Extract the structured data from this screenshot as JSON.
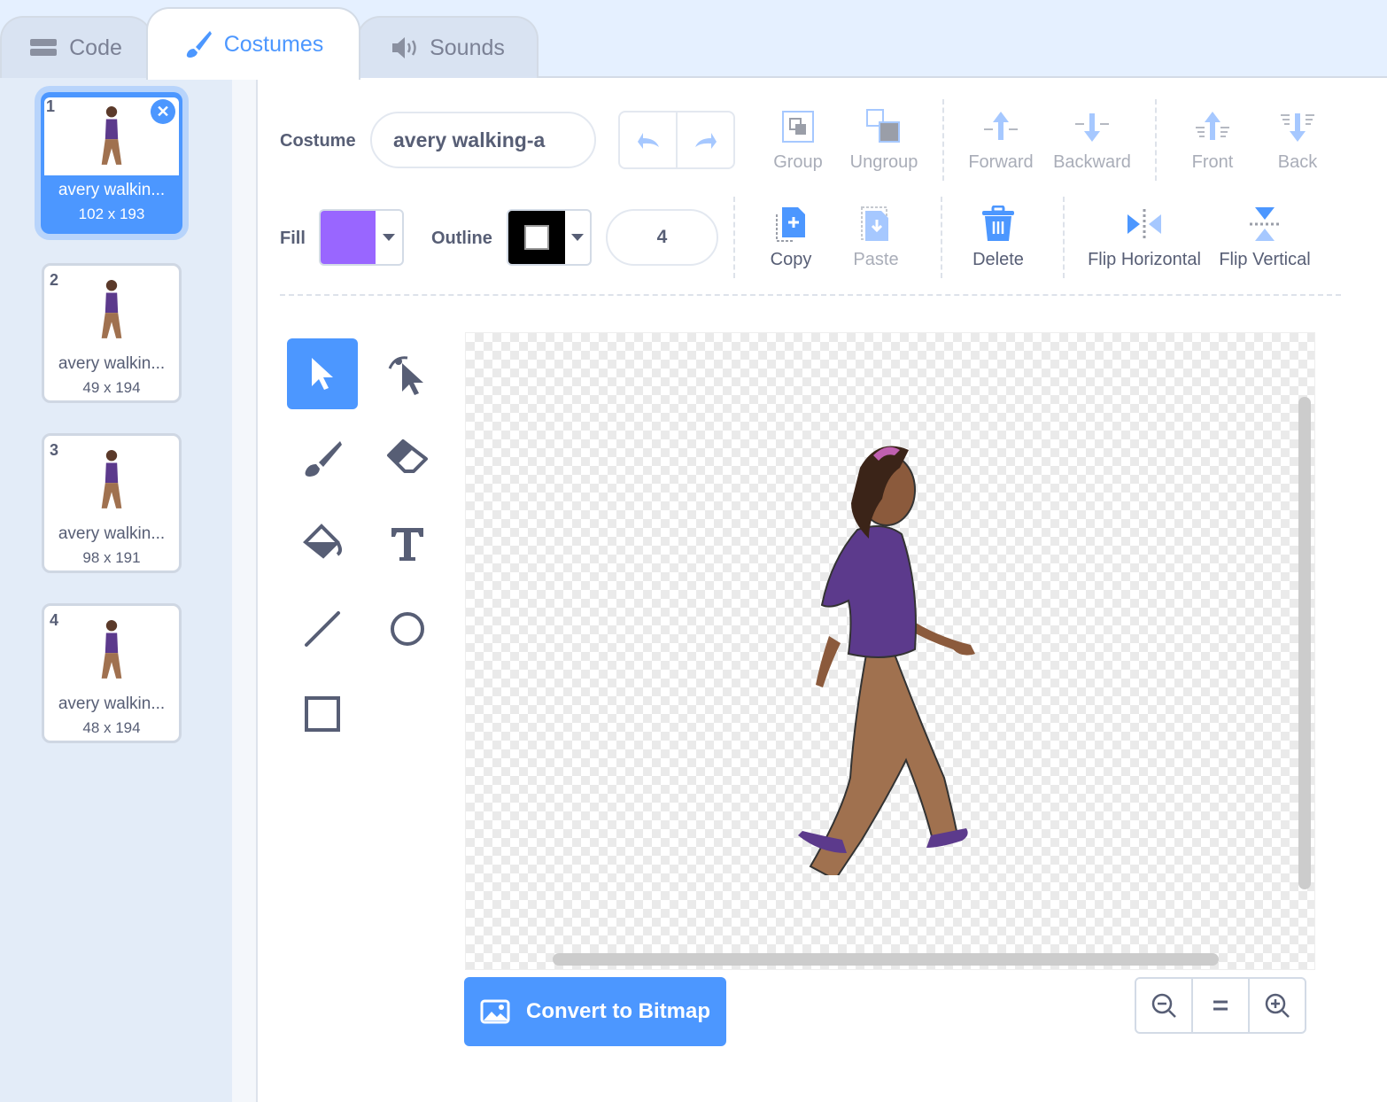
{
  "tabs": [
    {
      "label": "Code",
      "icon": "code-icon"
    },
    {
      "label": "Costumes",
      "icon": "brush-icon",
      "active": true
    },
    {
      "label": "Sounds",
      "icon": "speaker-icon"
    }
  ],
  "costumes": [
    {
      "number": "1",
      "name": "avery walkin...",
      "size": "102 x 193",
      "selected": true
    },
    {
      "number": "2",
      "name": "avery walkin...",
      "size": "49 x 194"
    },
    {
      "number": "3",
      "name": "avery walkin...",
      "size": "98 x 191"
    },
    {
      "number": "4",
      "name": "avery walkin...",
      "size": "48 x 194"
    }
  ],
  "editor": {
    "costume_label": "Costume",
    "costume_name": "avery walking-a",
    "fill_label": "Fill",
    "fill_color": "#9966ff",
    "outline_label": "Outline",
    "outline_color": "#000000",
    "outline_width": "4",
    "buttons": {
      "group": "Group",
      "ungroup": "Ungroup",
      "forward": "Forward",
      "backward": "Backward",
      "front": "Front",
      "back": "Back",
      "copy": "Copy",
      "paste": "Paste",
      "delete": "Delete",
      "flip_h": "Flip Horizontal",
      "flip_v": "Flip Vertical"
    },
    "convert_label": "Convert to Bitmap",
    "accent": "#4c97ff"
  }
}
